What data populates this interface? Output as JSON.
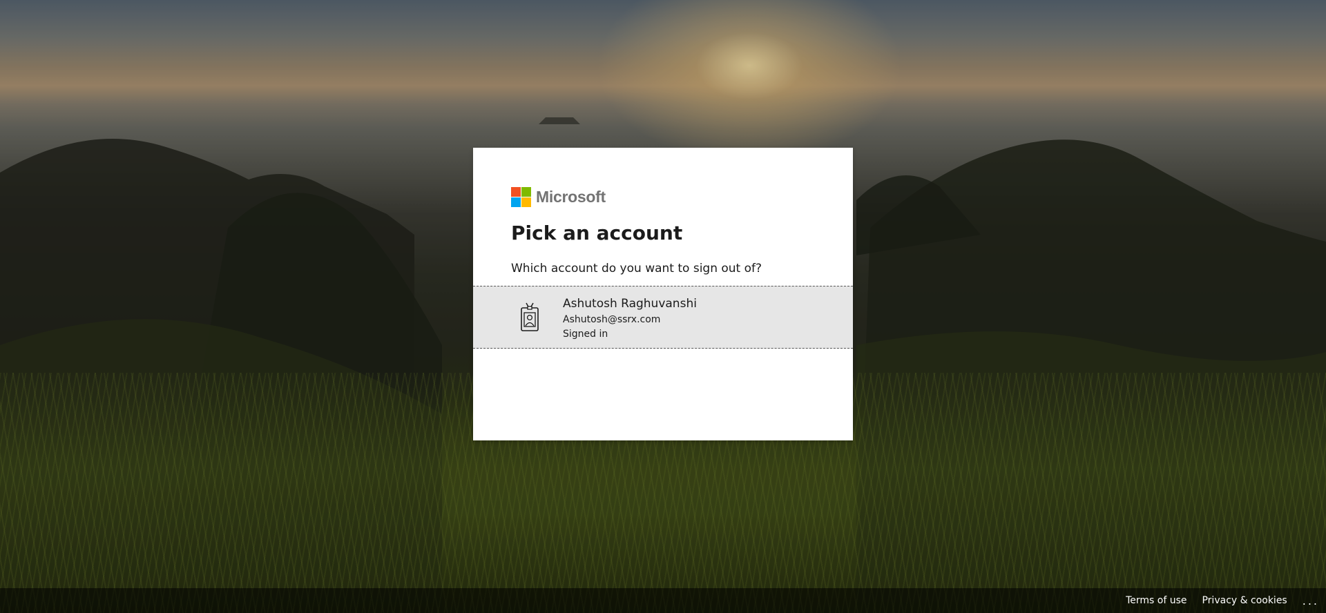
{
  "brand": {
    "name": "Microsoft",
    "logo_colors": [
      "#f25022",
      "#7fba00",
      "#00a4ef",
      "#ffb900"
    ]
  },
  "page": {
    "title": "Pick an account",
    "subtitle": "Which account do you want to sign out of?"
  },
  "accounts": [
    {
      "name": "Ashutosh Raghuvanshi",
      "email": "Ashutosh@ssrx.com",
      "status": "Signed in",
      "icon": "badge-icon"
    }
  ],
  "footer": {
    "terms": "Terms of use",
    "privacy": "Privacy & cookies",
    "more": "..."
  },
  "colors": {
    "card_bg": "#ffffff",
    "tile_bg": "#e6e6e6",
    "text": "#1b1b1b",
    "logo_text": "#737373"
  }
}
